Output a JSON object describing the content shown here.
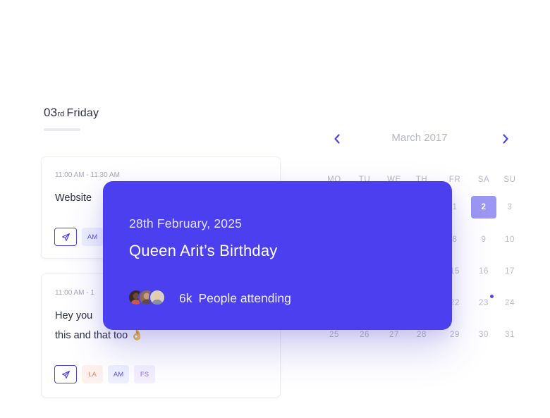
{
  "day": {
    "number": "03",
    "suffix": "rd",
    "weekday": "Friday"
  },
  "events": [
    {
      "time": "11:00 AM - 11:30 AM",
      "text": "Website ",
      "tags": [
        "AM"
      ]
    },
    {
      "time": "11:00 AM - 1",
      "text_line1": "Hey you",
      "text_line2": "this and that too 👌",
      "tags": [
        "LA",
        "AM",
        "FS"
      ]
    }
  ],
  "calendar": {
    "month": "March 2017",
    "weekdays": [
      "MO",
      "TU",
      "WE",
      "TH",
      "FR",
      "SA",
      "SU"
    ],
    "row1": [
      "1",
      "2",
      "3"
    ],
    "row2": [
      "8",
      "9",
      "10"
    ],
    "row3": [
      "15",
      "16",
      "17"
    ],
    "row4": [
      "22",
      "23",
      "24"
    ],
    "row5": [
      "25",
      "26",
      "27",
      "28",
      "29",
      "30",
      "31"
    ],
    "selected_day": "2"
  },
  "popup": {
    "date": "28th February, 2025",
    "title": "Queen Arit’s Birthday",
    "attendee_count": "6k",
    "attendee_label": "People attending"
  },
  "colors": {
    "accent": "#4b3ff0",
    "selected_day": "#9b97f2",
    "tag_la": "#f0856b",
    "tag_am": "#5751e8",
    "tag_fs": "#8e6ae6"
  },
  "icons": [
    "send-icon",
    "chevron-left-icon",
    "chevron-right-icon",
    "avatar-group"
  ]
}
